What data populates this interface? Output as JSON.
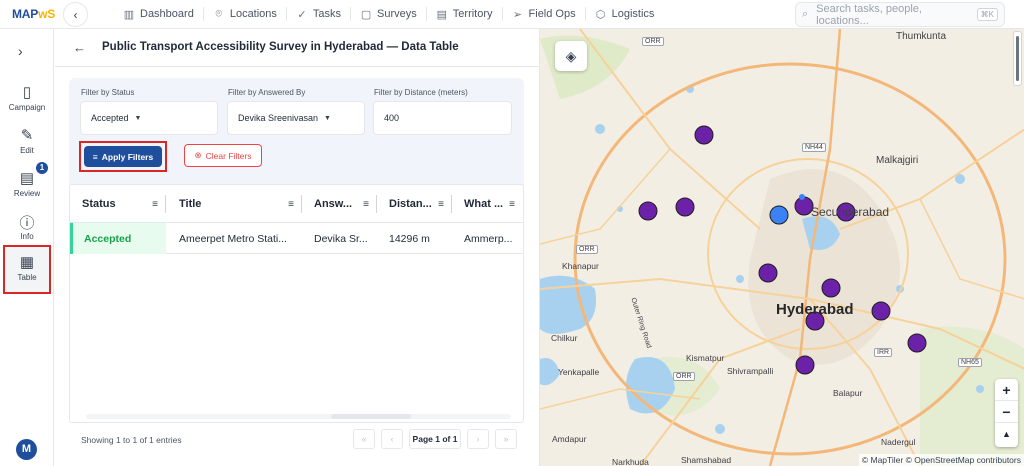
{
  "app": {
    "logo_main": "MAP",
    "logo_accent": "ᴡS"
  },
  "nav": [
    {
      "label": "Dashboard",
      "icon": "chart-bars-icon",
      "glyph": "▥"
    },
    {
      "label": "Locations",
      "icon": "map-pin-icon",
      "glyph": "⌾"
    },
    {
      "label": "Tasks",
      "icon": "check-icon",
      "glyph": "✓"
    },
    {
      "label": "Surveys",
      "icon": "clipboard-icon",
      "glyph": "▢"
    },
    {
      "label": "Territory",
      "icon": "map-icon",
      "glyph": "▤"
    },
    {
      "label": "Field Ops",
      "icon": "send-icon",
      "glyph": "➢"
    },
    {
      "label": "Logistics",
      "icon": "box-icon",
      "glyph": "⬡"
    }
  ],
  "search": {
    "placeholder": "Search tasks, people, locations...",
    "shortcut": "⌘K"
  },
  "rail": {
    "items": [
      {
        "label": "Campaign",
        "icon": "clipboard-icon",
        "glyph": "▯"
      },
      {
        "label": "Edit",
        "icon": "edit-icon",
        "glyph": "✎"
      },
      {
        "label": "Review",
        "icon": "document-icon",
        "glyph": "▤"
      },
      {
        "label": "Info",
        "icon": "info-icon",
        "glyph": "ⓘ"
      },
      {
        "label": "Table",
        "icon": "grid-icon",
        "glyph": "▦"
      }
    ],
    "review_badge": "1",
    "avatar_initial": "M"
  },
  "page": {
    "title": "Public Transport Accessibility Survey in Hyderabad — Data Table"
  },
  "filters": {
    "status": {
      "label": "Filter by Status",
      "value": "Accepted"
    },
    "answered_by": {
      "label": "Filter by Answered By",
      "value": "Devika Sreenivasan"
    },
    "distance": {
      "label": "Filter by Distance (meters)",
      "value": "400"
    },
    "apply_label": "Apply Filters",
    "clear_label": "Clear Filters"
  },
  "table": {
    "columns": [
      "Status",
      "Title",
      "Answ...",
      "Distan...",
      "What ..."
    ],
    "rows": [
      [
        "Accepted",
        "Ameerpet Metro Stati...",
        "Devika Sr...",
        "14296 m",
        "Ammerp..."
      ]
    ]
  },
  "footer": {
    "showing": "Showing 1 to 1 of 1 entries",
    "page_label": "Page 1 of 1"
  },
  "map": {
    "labels": {
      "thumkunta": "Thumkunta",
      "malkajgiri": "Malkajgiri",
      "secunderabad": "Secunderabad",
      "hyderabad": "Hyderabad",
      "khanapur": "Khanapur",
      "chilkur": "Chilkur",
      "kismatpur": "Kismatpur",
      "yenkapalle": "Yenkapalle",
      "shivrampalli": "Shivrampalli",
      "balapur": "Balapur",
      "amdapur": "Amdapur",
      "nadergul": "Nadergul",
      "narkhuda": "Narkhuda",
      "shamshabad": "Shamshabad",
      "outer_ring_road": "Outer Ring Road",
      "orr1": "ORR",
      "orr2": "ORR",
      "orr3": "ORR",
      "nh44": "NH44",
      "nh65": "NH65",
      "irr": "IRR"
    },
    "attribution": "© MapTiler © OpenStreetMap contributors",
    "marker_color": "#6b21a8",
    "selected_color": "#3b82f6"
  }
}
